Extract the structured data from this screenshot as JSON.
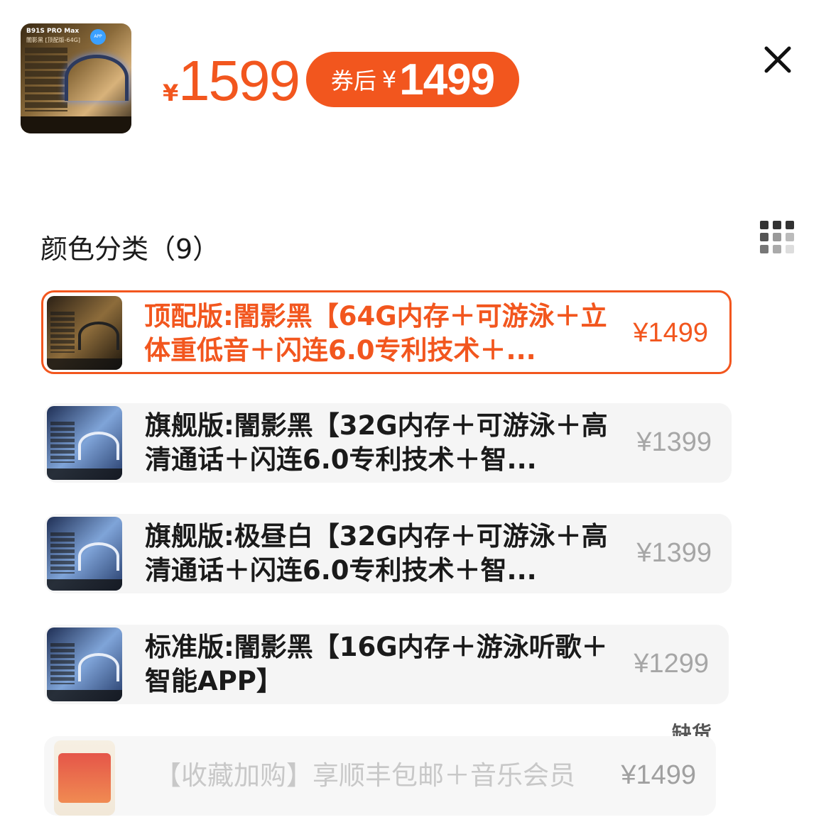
{
  "header": {
    "product_thumb_title": "B91S PRO Max",
    "product_thumb_subtitle": "闇影黑 [顶配版-64G]",
    "product_thumb_badge": "APP",
    "price_symbol": "¥",
    "price": "1599",
    "coupon": {
      "label": "券后",
      "symbol": "¥",
      "price": "1499"
    },
    "accent_color": "#f2561e"
  },
  "section": {
    "title": "颜色分类（9）"
  },
  "options": [
    {
      "label": "顶配版:闇影黑【64G内存＋可游泳＋立体重低音＋闪连6.0专利技术＋...",
      "price": "¥1499",
      "selected": true,
      "thumb_style": "dark"
    },
    {
      "label": "旗舰版:闇影黑【32G内存＋可游泳＋高清通话＋闪连6.0专利技术＋智...",
      "price": "¥1399",
      "selected": false,
      "thumb_style": "blue"
    },
    {
      "label": "旗舰版:极昼白【32G内存＋可游泳＋高清通话＋闪连6.0专利技术＋智...",
      "price": "¥1399",
      "selected": false,
      "thumb_style": "blue"
    },
    {
      "label": "标准版:闇影黑【16G内存＋游泳听歌＋智能APP】",
      "price": "¥1299",
      "selected": false,
      "thumb_style": "blue"
    },
    {
      "label": "【收藏加购】享顺丰包邮＋音乐会员",
      "price": "¥1499",
      "selected": false,
      "sold_out": true,
      "sold_out_label": "缺货",
      "thumb_style": "promo"
    }
  ],
  "icons": {
    "close": "close-icon",
    "grid": "grid-view-icon"
  }
}
